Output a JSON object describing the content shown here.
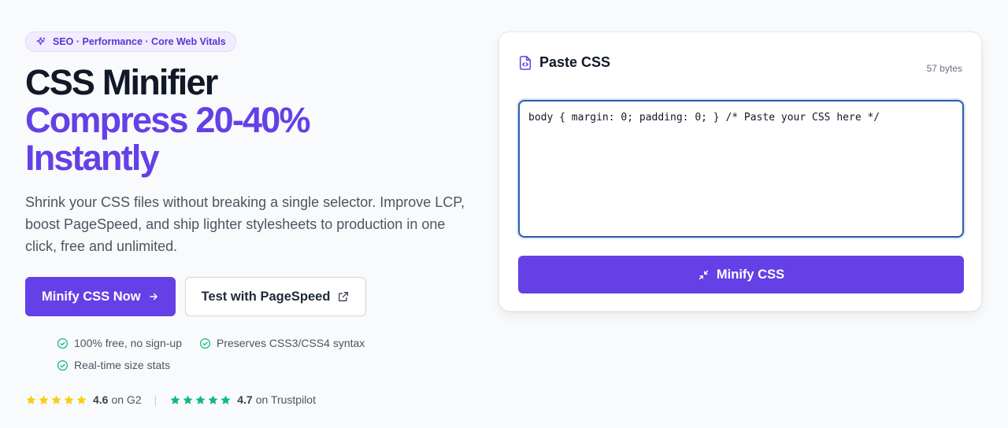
{
  "hero": {
    "badge": "SEO · Performance · Core Web Vitals",
    "title_line1": "CSS Minifier",
    "title_line2": "Compress 20-40%",
    "title_line3": "Instantly",
    "lead": "Shrink your CSS files without breaking a single selector. Improve LCP, boost PageSpeed, and ship lighter stylesheets to production in one click, free and unlimited.",
    "primary_cta": "Minify CSS Now",
    "secondary_cta": "Test with PageSpeed",
    "features": [
      "100% free, no sign-up",
      "Preserves CSS3/CSS4 syntax",
      "Real-time size stats"
    ],
    "ratings": [
      {
        "value": "4.6",
        "source": "on G2",
        "star_color": "#facc15",
        "stars": 5
      },
      {
        "value": "4.7",
        "source": "on Trustpilot",
        "star_color": "#10b981",
        "stars": 5
      }
    ],
    "separator": "|"
  },
  "tool": {
    "title": "Paste CSS",
    "size": "57 bytes",
    "input_value": "body { margin: 0; padding: 0; } /* Paste your CSS here */",
    "button_label": "Minify CSS"
  },
  "colors": {
    "accent": "#6440e6",
    "check": "#10b981",
    "star_g2": "#facc15",
    "star_trustpilot": "#10b981"
  }
}
